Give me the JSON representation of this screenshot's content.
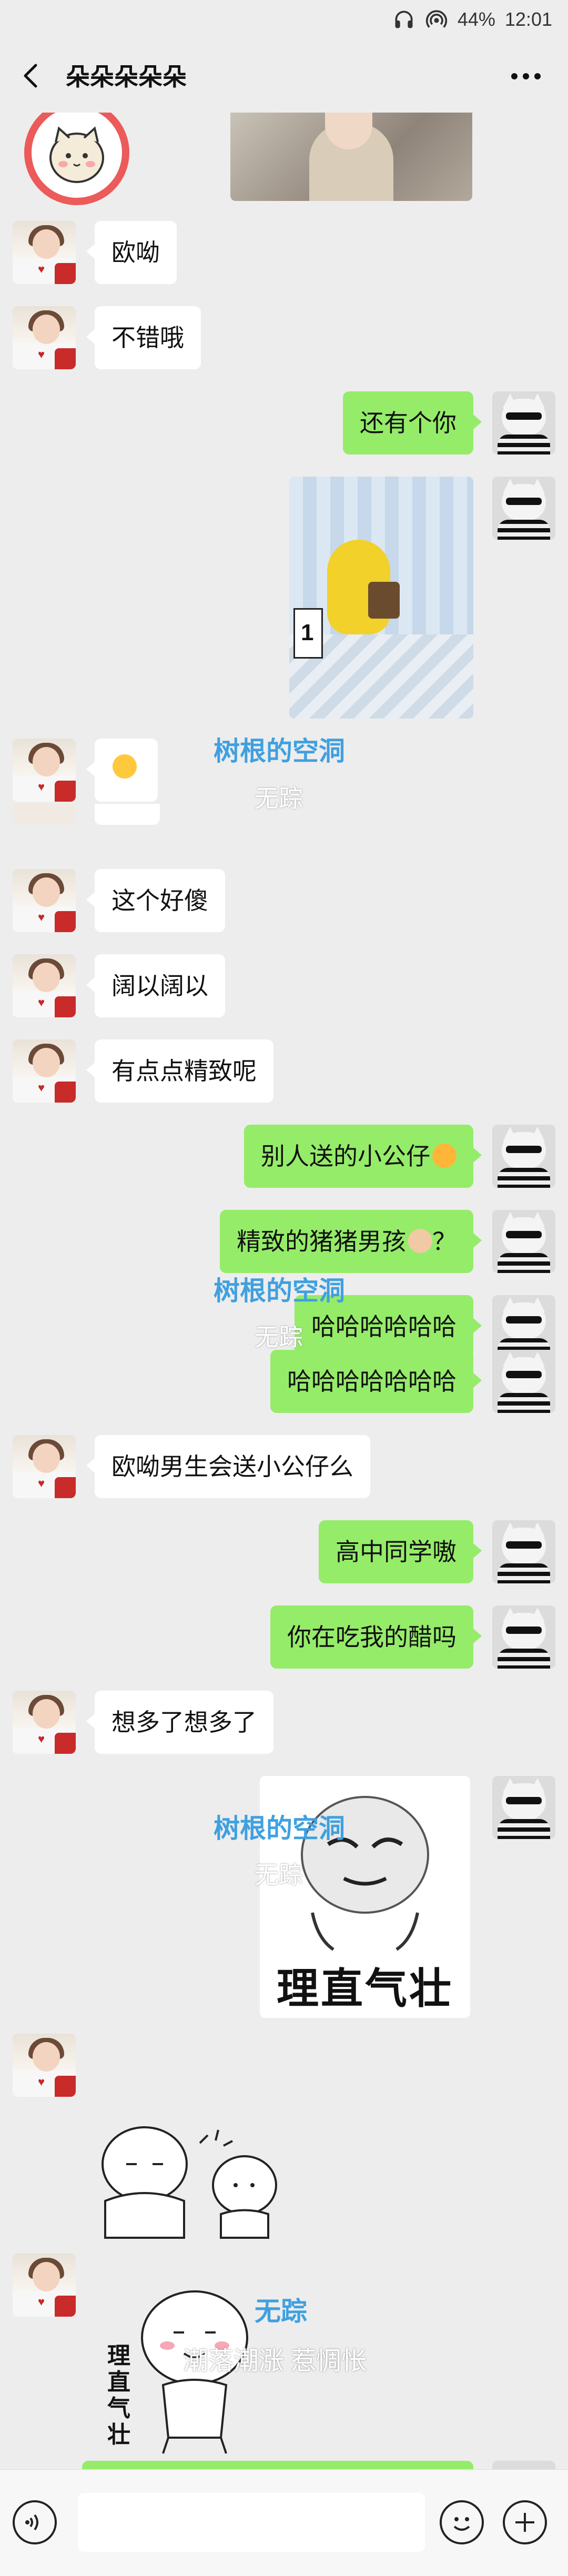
{
  "status_bar": {
    "battery": "44%",
    "time": "12:01",
    "icons": [
      "headset-icon",
      "hotspot-icon"
    ]
  },
  "header": {
    "title": "朵朵朵朵朵",
    "back_icon": "chevron-left-icon",
    "more_icon": "more-dots-icon"
  },
  "messages": [
    {
      "side": "left",
      "type": "text",
      "text": "欧呦"
    },
    {
      "side": "left",
      "type": "text",
      "text": "不错哦"
    },
    {
      "side": "right",
      "type": "text",
      "text": "还有个你"
    },
    {
      "side": "right",
      "type": "image",
      "desc": "photo-yellow-toy"
    },
    {
      "side": "left",
      "type": "emoji",
      "emoji": "laughing-tears-emoji"
    },
    {
      "side": "left",
      "type": "text",
      "text": "这个好傻"
    },
    {
      "side": "left",
      "type": "text",
      "text": "阔以阔以"
    },
    {
      "side": "left",
      "type": "text",
      "text": "有点点精致呢"
    },
    {
      "side": "right",
      "type": "text",
      "text": "别人送的小公仔",
      "emoji": "sleepy-emoji"
    },
    {
      "side": "right",
      "type": "text",
      "text": "精致的猪猪男孩",
      "emoji": "face-emoji",
      "suffix": "？"
    },
    {
      "side": "right",
      "type": "text",
      "text": "哈哈哈哈哈哈"
    },
    {
      "side": "right",
      "type": "text",
      "text": "哈哈哈哈哈哈哈"
    },
    {
      "side": "left",
      "type": "text",
      "text": "欧呦男生会送小公仔么"
    },
    {
      "side": "right",
      "type": "text",
      "text": "高中同学嗷"
    },
    {
      "side": "right",
      "type": "text",
      "text": "你在吃我的醋吗"
    },
    {
      "side": "left",
      "type": "text",
      "text": "想多了想多了"
    },
    {
      "side": "right",
      "type": "sticker",
      "caption": "理直气壮"
    },
    {
      "side": "left",
      "type": "sticker",
      "desc": "two-doodles-sticker"
    },
    {
      "side": "left",
      "type": "sticker",
      "caption": "理直气壮",
      "desc": "doodle-sticker"
    }
  ],
  "watermarks": {
    "name1": "树根的空洞",
    "name2": "无踪",
    "caption": "潮落潮涨 惹惆怅"
  },
  "colors": {
    "background": "#ededed",
    "outgoing_bubble": "#95ec69",
    "incoming_bubble": "#ffffff",
    "watermark_blue": "#3fa0e0"
  }
}
